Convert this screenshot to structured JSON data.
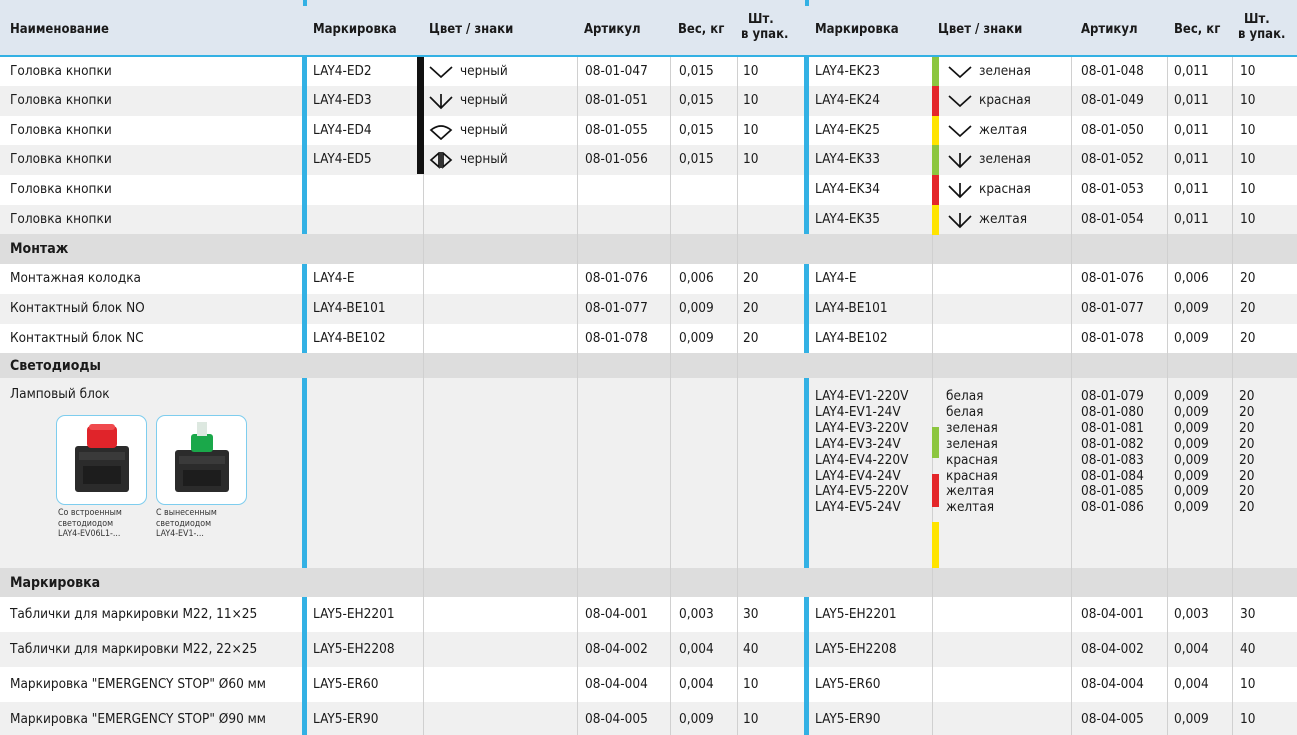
{
  "colors": {
    "header_bg": "#dfe7f0",
    "accent_blue": "#33b1e4",
    "alt_row": "#f0f0f0",
    "section_bg": "#dddddd",
    "grid": "#d0d0d0",
    "black": "#111111",
    "green": "#8cc63f",
    "red": "#e4262a",
    "yellow": "#ffe400"
  },
  "header": {
    "name": "Наименование",
    "mark1": "Маркировка",
    "color1": "Цвет / знаки",
    "art1": "Артикул",
    "weight1": "Вес, кг",
    "qty1_line1": "Шт.",
    "qty1_line2": "в упак.",
    "mark2": "Маркировка",
    "color2": "Цвет / знаки",
    "art2": "Артикул",
    "weight2": "Вес, кг",
    "qty2_line1": "Шт.",
    "qty2_line2": "в упак."
  },
  "button_heads": [
    {
      "name": "Головка кнопки",
      "mark1": "LAY4-ED2",
      "sym1": "chevron-down-icon",
      "color1_label": "черный",
      "color1": "black",
      "art1": "08-01-047",
      "weight1": "0,015",
      "qty1": "10",
      "mark2": "LAY4-EK23",
      "sym2": "chevron-down-icon",
      "color2_label": "зеленая",
      "color2": "green",
      "art2": "08-01-048",
      "weight2": "0,011",
      "qty2": "10"
    },
    {
      "name": "Головка кнопки",
      "mark1": "LAY4-ED3",
      "sym1": "arrow-down-icon",
      "color1_label": "черный",
      "color1": "black",
      "art1": "08-01-051",
      "weight1": "0,015",
      "qty1": "10",
      "mark2": "LAY4-EK24",
      "sym2": "chevron-down-icon",
      "color2_label": "красная",
      "color2": "red",
      "art2": "08-01-049",
      "weight2": "0,011",
      "qty2": "10"
    },
    {
      "name": "Головка кнопки",
      "mark1": "LAY4-ED4",
      "sym1": "rotate-arrow-icon",
      "color1_label": "черный",
      "color1": "black",
      "art1": "08-01-055",
      "weight1": "0,015",
      "qty1": "10",
      "mark2": "LAY4-EK25",
      "sym2": "chevron-down-icon",
      "color2_label": "желтая",
      "color2": "yellow",
      "art2": "08-01-050",
      "weight2": "0,011",
      "qty2": "10"
    },
    {
      "name": "Головка кнопки",
      "mark1": "LAY4-ED5",
      "sym1": "double-arrow-icon",
      "color1_label": "черный",
      "color1": "black",
      "art1": "08-01-056",
      "weight1": "0,015",
      "qty1": "10",
      "mark2": "LAY4-EK33",
      "sym2": "arrow-down-icon",
      "color2_label": "зеленая",
      "color2": "green",
      "art2": "08-01-052",
      "weight2": "0,011",
      "qty2": "10"
    },
    {
      "name": "Головка кнопки",
      "mark1": "",
      "sym1": "",
      "color1_label": "",
      "color1": "",
      "art1": "",
      "weight1": "",
      "qty1": "",
      "mark2": "LAY4-EK34",
      "sym2": "arrow-down-icon",
      "color2_label": "красная",
      "color2": "red",
      "art2": "08-01-053",
      "weight2": "0,011",
      "qty2": "10"
    },
    {
      "name": "Головка кнопки",
      "mark1": "",
      "sym1": "",
      "color1_label": "",
      "color1": "",
      "art1": "",
      "weight1": "",
      "qty1": "",
      "mark2": "LAY4-EK35",
      "sym2": "arrow-down-icon",
      "color2_label": "желтая",
      "color2": "yellow",
      "art2": "08-01-054",
      "weight2": "0,011",
      "qty2": "10"
    }
  ],
  "montage": {
    "title": "Монтаж",
    "rows": [
      {
        "name": "Монтажная колодка",
        "mark1": "LAY4-E",
        "art1": "08-01-076",
        "weight1": "0,006",
        "qty1": "20",
        "mark2": "LAY4-E",
        "art2": "08-01-076",
        "weight2": "0,006",
        "qty2": "20"
      },
      {
        "name": "Контактный блок NO",
        "mark1": "LAY4-BE101",
        "art1": "08-01-077",
        "weight1": "0,009",
        "qty1": "20",
        "mark2": "LAY4-BE101",
        "art2": "08-01-077",
        "weight2": "0,009",
        "qty2": "20"
      },
      {
        "name": "Контактный блок NC",
        "mark1": "LAY4-BE102",
        "art1": "08-01-078",
        "weight1": "0,009",
        "qty1": "20",
        "mark2": "LAY4-BE102",
        "art2": "08-01-078",
        "weight2": "0,009",
        "qty2": "20"
      }
    ]
  },
  "leds": {
    "title": "Светодиоды",
    "name": "Ламповый блок",
    "mark2": "LAY4-EV1-220V\nLAY4-EV1-24V\nLAY4-EV3-220V\nLAY4-EV3-24V\nLAY4-EV4-220V\nLAY4-EV4-24V\nLAY4-EV5-220V\nLAY4-EV5-24V",
    "color2": "белая\nбелая\nзеленая\nзеленая\nкрасная\nкрасная\nжелтая\nжелтая",
    "art2": "08-01-079\n08-01-080\n08-01-081\n08-01-082\n08-01-083\n08-01-084\n08-01-085\n08-01-086",
    "weight2": "0,009\n0,009\n0,009\n0,009\n0,009\n0,009\n0,009\n0,009",
    "qty2": "20\n20\n20\n20\n20\n20\n20\n20",
    "images": [
      {
        "caption_l1": "Со встроенным",
        "caption_l2": "светодиодом",
        "caption_l3": "LAY4-EV06L1-...",
        "cap_color": "red"
      },
      {
        "caption_l1": "С вынесенным",
        "caption_l2": "светодиодом",
        "caption_l3": "LAY4-EV1-...",
        "cap_color": "green"
      }
    ]
  },
  "marking": {
    "title": "Маркировка",
    "rows": [
      {
        "name": "Таблички для маркировки М22, 11×25",
        "mark1": "LAY5-EH2201",
        "art1": "08-04-001",
        "weight1": "0,003",
        "qty1": "30",
        "mark2": "LAY5-EH2201",
        "art2": "08-04-001",
        "weight2": "0,003",
        "qty2": "30"
      },
      {
        "name": "Таблички для маркировки М22, 22×25",
        "mark1": "LAY5-EH2208",
        "art1": "08-04-002",
        "weight1": "0,004",
        "qty1": "40",
        "mark2": "LAY5-EH2208",
        "art2": "08-04-002",
        "weight2": "0,004",
        "qty2": "40"
      },
      {
        "name": "Маркировка \"EMERGENCY STOP\" Ø60 мм",
        "mark1": "LAY5-ER60",
        "art1": "08-04-004",
        "weight1": "0,004",
        "qty1": "10",
        "mark2": "LAY5-ER60",
        "art2": "08-04-004",
        "weight2": "0,004",
        "qty2": "10"
      },
      {
        "name": "Маркировка \"EMERGENCY STOP\" Ø90 мм",
        "mark1": "LAY5-ER90",
        "art1": "08-04-005",
        "weight1": "0,009",
        "qty1": "10",
        "mark2": "LAY5-ER90",
        "art2": "08-04-005",
        "weight2": "0,009",
        "qty2": "10"
      }
    ]
  }
}
